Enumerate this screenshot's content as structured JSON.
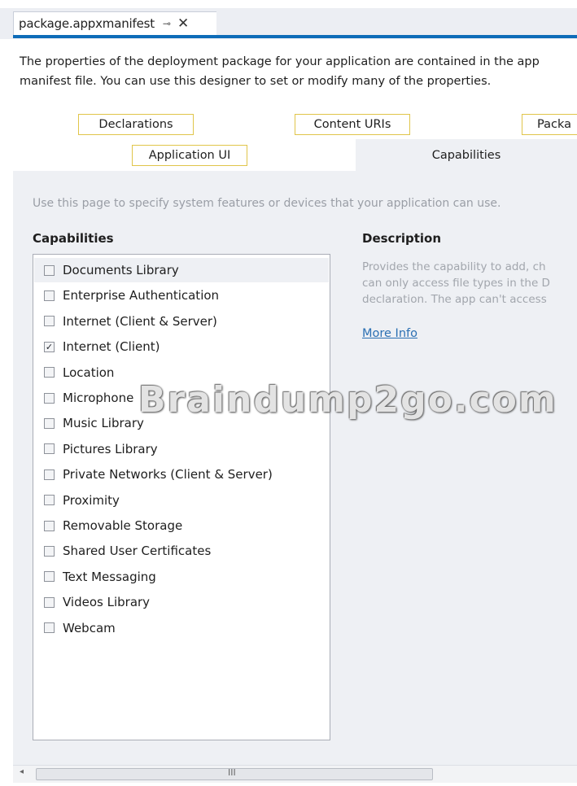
{
  "document_tab": {
    "title": "package.appxmanifest",
    "pin_glyph": "⊸",
    "close_glyph": "✕"
  },
  "intro": "The properties of the deployment package for your application are contained in the app\nmanifest file. You can use this designer to set or modify many of the properties.",
  "tabs": {
    "declarations": "Declarations",
    "content_uris": "Content URIs",
    "packaging": "Packa",
    "application_ui": "Application UI",
    "capabilities": "Capabilities"
  },
  "hint": "Use this page to specify system features or devices that your application can use.",
  "capabilities_header": "Capabilities",
  "description_header": "Description",
  "capabilities": [
    {
      "label": "Documents Library",
      "checked": false,
      "selected": true
    },
    {
      "label": "Enterprise Authentication",
      "checked": false,
      "selected": false
    },
    {
      "label": "Internet (Client & Server)",
      "checked": false,
      "selected": false
    },
    {
      "label": "Internet (Client)",
      "checked": true,
      "selected": false
    },
    {
      "label": "Location",
      "checked": false,
      "selected": false
    },
    {
      "label": "Microphone",
      "checked": false,
      "selected": false
    },
    {
      "label": "Music Library",
      "checked": false,
      "selected": false
    },
    {
      "label": "Pictures Library",
      "checked": false,
      "selected": false
    },
    {
      "label": "Private Networks (Client & Server)",
      "checked": false,
      "selected": false
    },
    {
      "label": "Proximity",
      "checked": false,
      "selected": false
    },
    {
      "label": "Removable Storage",
      "checked": false,
      "selected": false
    },
    {
      "label": "Shared User Certificates",
      "checked": false,
      "selected": false
    },
    {
      "label": "Text Messaging",
      "checked": false,
      "selected": false
    },
    {
      "label": "Videos Library",
      "checked": false,
      "selected": false
    },
    {
      "label": "Webcam",
      "checked": false,
      "selected": false
    }
  ],
  "description_text": "Provides the capability to add, ch\ncan only access file types in the D\ndeclaration. The app can't access",
  "more_info": "More Info",
  "watermark": "Braindump2go.com",
  "scrollbar": {
    "left_arrow": "◂",
    "grip": "III"
  },
  "colors": {
    "accent": "#0e6cb8",
    "tab_border": "#e0c54a",
    "link": "#2b6fb3"
  }
}
